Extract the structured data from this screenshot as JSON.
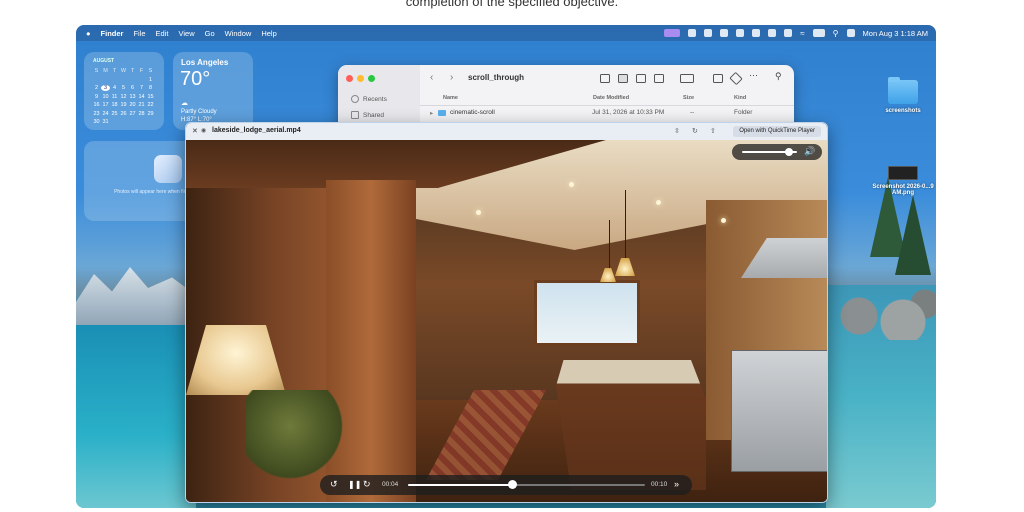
{
  "caption": "completion of the specified objective.",
  "menubar": {
    "apple": "",
    "app": "Finder",
    "items": [
      "File",
      "Edit",
      "View",
      "Go",
      "Window",
      "Help"
    ],
    "datetime": "Mon Aug 3  1:18 AM"
  },
  "calendar": {
    "month": "AUGUST",
    "weekdays": [
      "S",
      "M",
      "T",
      "W",
      "T",
      "F",
      "S"
    ],
    "days": [
      "",
      "",
      "",
      "",
      "",
      "",
      "1",
      "2",
      "3",
      "4",
      "5",
      "6",
      "7",
      "8",
      "9",
      "10",
      "11",
      "12",
      "13",
      "14",
      "15",
      "16",
      "17",
      "18",
      "19",
      "20",
      "21",
      "22",
      "23",
      "24",
      "25",
      "26",
      "27",
      "28",
      "29",
      "30",
      "31"
    ],
    "today": "3"
  },
  "weather": {
    "city": "Los Angeles",
    "temp": "70°",
    "condition": "Partly Cloudy",
    "hilo": "H:87° L:70°"
  },
  "photos_widget": {
    "text": "Photos will appear here when finished processing"
  },
  "desktop_icons": [
    {
      "label": "screenshots",
      "icon": "folder-icon"
    },
    {
      "label": "Screenshot 2026-0...9 AM.png",
      "icon": "image-file-icon"
    }
  ],
  "finder": {
    "title": "scroll_through",
    "sidebar": [
      "Recents",
      "Shared"
    ],
    "columns": {
      "name": "Name",
      "date": "Date Modified",
      "size": "Size",
      "kind": "Kind"
    },
    "rows": [
      {
        "name": "cinematic-scroll",
        "date": "Jul 31, 2026 at 10:33 PM",
        "size": "--",
        "kind": "Folder"
      }
    ]
  },
  "player": {
    "filename": "lakeside_lodge_aerial.mp4",
    "open_button": "Open with QuickTime Player",
    "elapsed": "00:04",
    "remaining": "00:10",
    "progress": 0.44,
    "volume": 0.85
  }
}
